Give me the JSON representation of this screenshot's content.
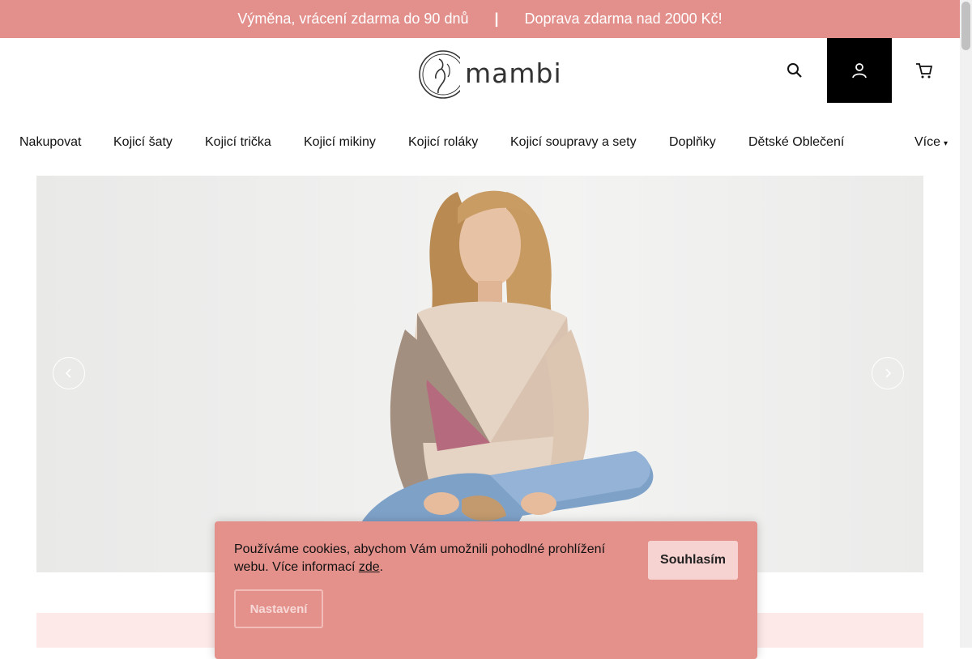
{
  "topbar": {
    "left_text": "Výměna, vrácení zdarma do 90 dnů",
    "separator": "|",
    "right_text": "Doprava zdarma nad 2000 Kč!",
    "color": "#e3908c"
  },
  "header": {
    "logo_text": "mambi",
    "icons": [
      "search-icon",
      "user-icon",
      "cart-icon"
    ]
  },
  "nav": {
    "items": [
      {
        "label": "Nakupovat"
      },
      {
        "label": "Kojicí šaty"
      },
      {
        "label": "Kojicí trička"
      },
      {
        "label": "Kojicí mikiny"
      },
      {
        "label": "Kojicí roláky"
      },
      {
        "label": "Kojicí soupravy a sety"
      },
      {
        "label": "Doplňky"
      },
      {
        "label": "Dětské Oblečení"
      }
    ],
    "more_label": "Více"
  },
  "hero": {
    "prev_icon": "chevron-left-icon",
    "next_icon": "chevron-right-icon"
  },
  "cookie": {
    "text_before": "Používáme cookies, abychom Vám umožnili pohodlné prohlížení webu. Více informací ",
    "link_text": "zde",
    "text_after": ".",
    "accept_label": "Souhlasím",
    "settings_label": "Nastavení",
    "color": "#e4918c"
  }
}
